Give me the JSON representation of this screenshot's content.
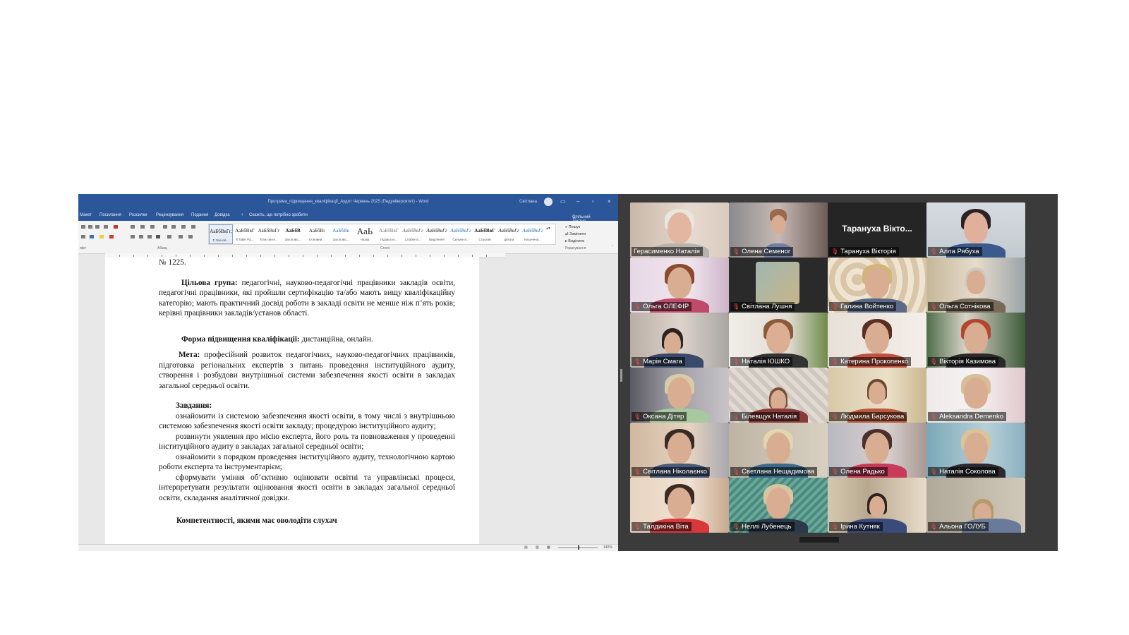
{
  "word": {
    "title": "Програма_підвищення_кваліфікації_Аудит Червень 2025 (Педуніверситет) - Word",
    "user": "Світлана",
    "menu": [
      "Макет",
      "Посилання",
      "Розсилки",
      "Рецензування",
      "Подання",
      "Довідка"
    ],
    "tell_me": "Скажіть, що потрібно зробити",
    "share": "Спільний доступ",
    "styles": [
      {
        "preview": "АаБбВвГг,",
        "name": "¶ Звичай..."
      },
      {
        "preview": "АаБбВвГ",
        "name": "¶ Table Pa..."
      },
      {
        "preview": "АаБбВвГг",
        "name": "¶ Без инте..."
      },
      {
        "preview": "АаБбВ",
        "name": "Заголово..."
      },
      {
        "preview": "АаБбВі",
        "name": "Основни..."
      },
      {
        "preview": "АаБбВв",
        "name": "Заголово..."
      },
      {
        "preview": "АаЬ",
        "name": "Назва"
      },
      {
        "preview": "АаБбВвГ",
        "name": "Підзаголо..."
      },
      {
        "preview": "АаБбВвГг",
        "name": "Слабке в..."
      },
      {
        "preview": "АаБбВвГг",
        "name": "Виділення"
      },
      {
        "preview": "АаБбВвГг",
        "name": "Сильне в..."
      },
      {
        "preview": "АаБбВвГ",
        "name": "Строгий"
      },
      {
        "preview": "АаБбВвГг",
        "name": "Цитата"
      },
      {
        "preview": "АаБбВвГг",
        "name": "Насичена..."
      }
    ],
    "editing": [
      "Пошук",
      "Замінити",
      "Виділити"
    ],
    "groups": {
      "font": "ифт",
      "paragraph": "Абзац",
      "styles": "Стилі",
      "editing": "Редагування"
    },
    "zoom": "140%"
  },
  "doc": {
    "line0": "№ 1225.",
    "target_label": "Цільова група:",
    "target_text": " педагогічні, науково-педагогічні працівники закладів освіти, педагогічні працівники, які пройшли сертифікацію та/або мають вищу кваліфікаційну категорію; мають практичний досвід роботи в закладі освіти не менше ніж п’ять років; керівні працівники закладів/установ області.",
    "form_label": "Форма підвищення кваліфікації:",
    "form_text": " дистанційна, онлайн.",
    "goal_label": "Мета:",
    "goal_text": " професійний розвиток педагогічних, науково-педагогічних працівників, підготовка регіональних експертів з питань проведення інституційного аудиту, створення і розбудови внутрішньої системи забезпечення якості освіти в закладах загальної середньої освіти.",
    "tasks_label": "Завдання:",
    "task1": "ознайомити із системою забезпечення якості освіти, в тому числі з внутрішньою системою забезпечення якості освіти закладу; процедурою інституційного аудиту;",
    "task2": "розвинути уявлення про місію експерта, його роль та повноваження у проведенні інституційного аудиту в закладах загальної середньої освіти;",
    "task3": "ознайомити з порядком проведення інституційного аудиту, технологічною картою роботи експерта та інструментарієм;",
    "task4": "сформувати уміння об’єктивно оцінювати освітні та управлінські процеси, інтерпретувати результати оцінювання якості освіти в закладах загальної середньої освіти, складання аналітичної довідки.",
    "competence": "Компетентності, якими має оволодіти слухач"
  },
  "participants": [
    "Герасименко Наталія",
    "Олена Семеног",
    "Тарануха Вікторія",
    "Алла Рябуха",
    "Ольга ОЛЕФІР",
    "Світлана Лушня",
    "Галина Войтенко",
    "Ольга Сотнікова",
    "Марія Смага",
    "Наталія ЮШКО",
    "Катерина Прокопенко",
    "Вікторія Казимова",
    "Оксана Дітяр",
    "Білевщук Наталія",
    "Людмила Барсукова",
    "Aleksandra Demenko",
    "Світлана Ніколаєнко",
    "Светлана Нещадимова",
    "Олена Радько",
    "Наталія Соколова",
    "Талдикіна Віта",
    "Неллі Лубенець",
    "Ірина Кутняк",
    "Альона ГОЛУБ"
  ],
  "no_video_label": "Тарануха Вікто...",
  "colors": {
    "word_blue": "#2b579a",
    "active_speaker": "#2ecc71",
    "muted_mic": "#ff4a4a"
  }
}
